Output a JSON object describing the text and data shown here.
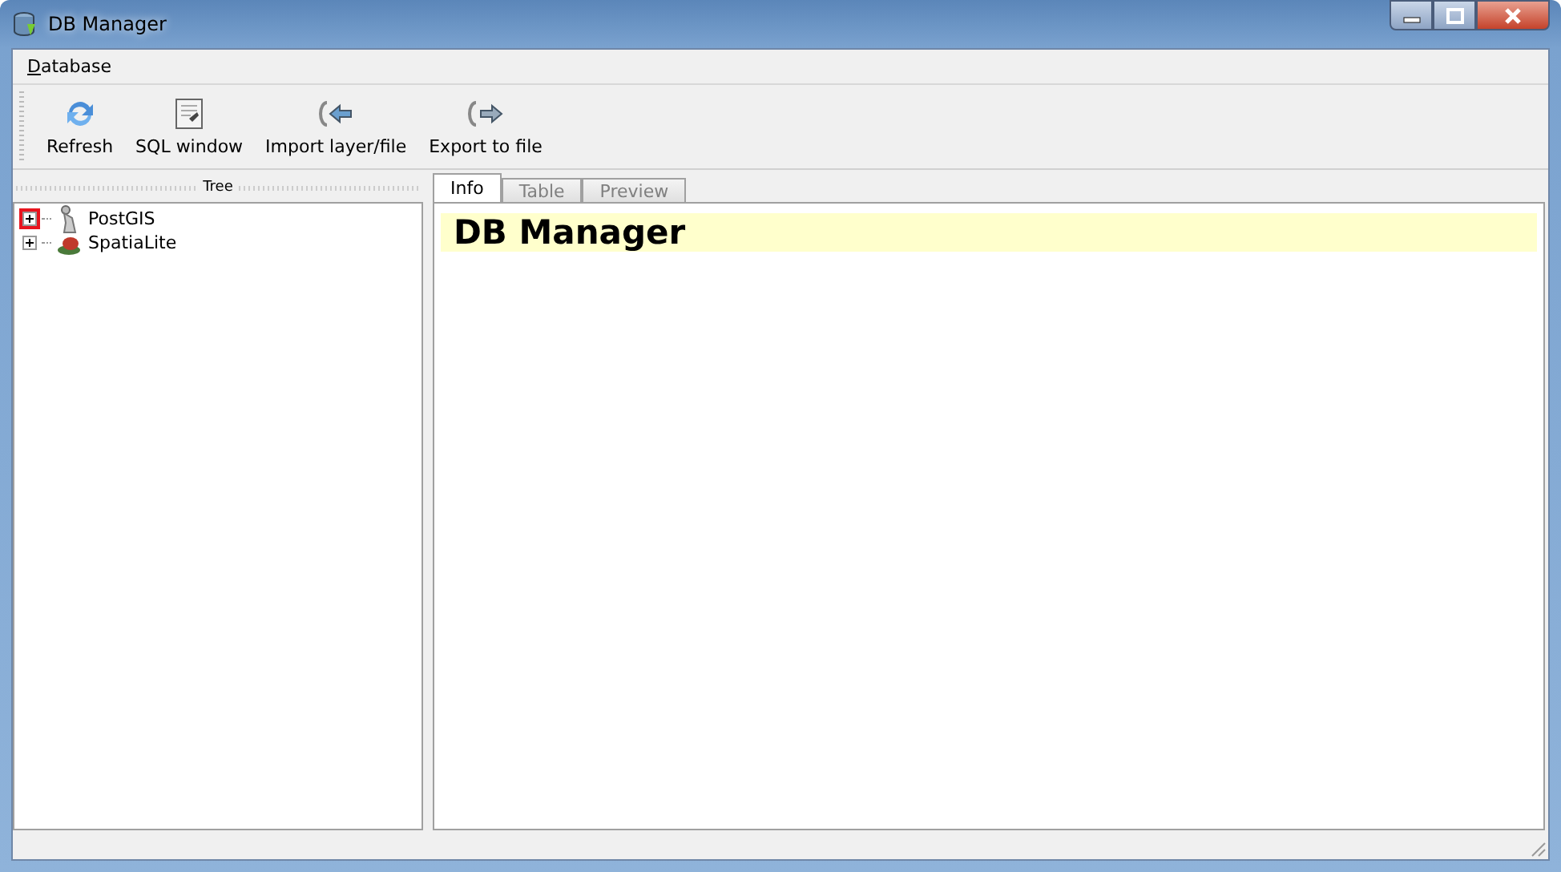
{
  "window": {
    "title": "DB Manager"
  },
  "menu": [
    {
      "label": "Database"
    }
  ],
  "toolbar": [
    {
      "label": "Refresh",
      "kind": "refresh"
    },
    {
      "label": "SQL window",
      "kind": "sql"
    },
    {
      "label": "Import layer/file",
      "kind": "import"
    },
    {
      "label": "Export to file",
      "kind": "export"
    }
  ],
  "dock": {
    "title": "Tree"
  },
  "tree": [
    {
      "label": "PostGIS",
      "kind": "postgis",
      "expanded": false,
      "highlighted": true
    },
    {
      "label": "SpatiaLite",
      "kind": "spatialite",
      "expanded": false,
      "highlighted": false
    }
  ],
  "tabs": [
    {
      "label": "Info",
      "selected": true,
      "disabled": false
    },
    {
      "label": "Table",
      "selected": false,
      "disabled": true
    },
    {
      "label": "Preview",
      "selected": false,
      "disabled": true
    }
  ],
  "info": {
    "heading": "DB Manager"
  }
}
